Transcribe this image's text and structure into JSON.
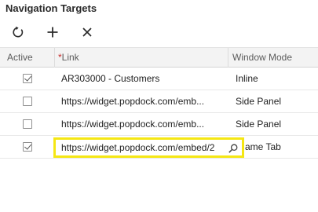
{
  "panel": {
    "title": "Navigation Targets"
  },
  "toolbar": {
    "refresh_icon": "refresh-icon",
    "add_icon": "plus-icon",
    "delete_icon": "close-icon"
  },
  "columns": {
    "active": "Active",
    "link_required": "*",
    "link": "Link",
    "window_mode": "Window Mode"
  },
  "rows": [
    {
      "active": true,
      "link": "AR303000 - Customers",
      "window_mode": "Inline"
    },
    {
      "active": false,
      "link": "https://widget.popdock.com/emb...",
      "window_mode": "Side Panel"
    },
    {
      "active": false,
      "link": "https://widget.popdock.com/emb...",
      "window_mode": "Side Panel"
    },
    {
      "active": true,
      "link_editing": "https://widget.popdock.com/embed/2",
      "window_mode": "ame Tab"
    }
  ],
  "colors": {
    "highlight": "#f5e714",
    "required": "#c62828",
    "header_bg": "#f3f3f3"
  }
}
